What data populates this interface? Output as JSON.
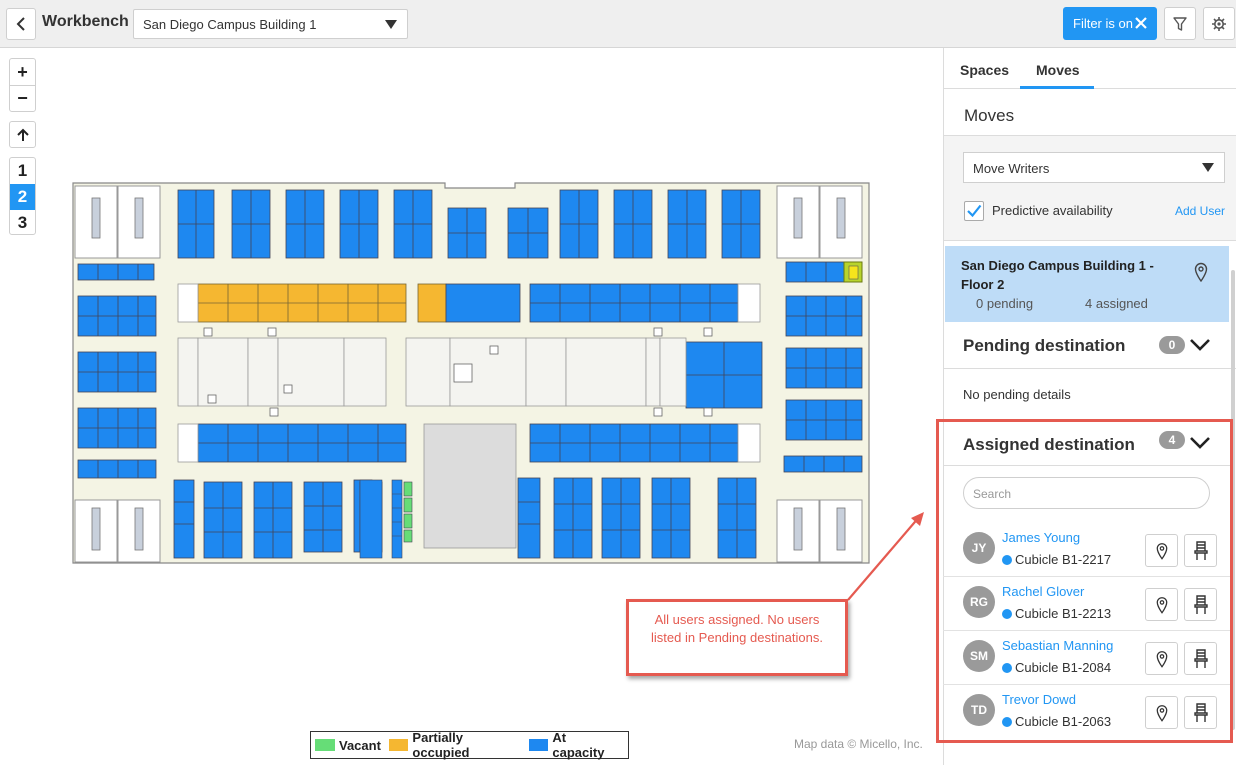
{
  "colors": {
    "accent": "#2196f3",
    "vacant": "#66dd77",
    "partially_occupied": "#f5b731",
    "at_capacity": "#1e88f0",
    "annotation": "#e55a50",
    "selected_card": "#bedcf7"
  },
  "toolbar": {
    "back_icon": "chevron-left-icon",
    "title": "Workbench",
    "building_select": "San Diego Campus Building 1",
    "filter_label": "Filter is on",
    "filter_icon": "funnel-icon",
    "settings_icon": "gear-icon"
  },
  "map_controls": {
    "zoom_in": "+",
    "zoom_out": "−",
    "floors": [
      "1",
      "2",
      "3"
    ],
    "active_floor": "2"
  },
  "legend": {
    "vacant": "Vacant",
    "partial": "Partially occupied",
    "capacity": "At capacity"
  },
  "map_credit": "Map data © Micello, Inc.",
  "annotation": {
    "text": "All users assigned. No users listed in Pending destinations."
  },
  "panel": {
    "tabs": [
      "Spaces",
      "Moves"
    ],
    "active_tab": "Moves",
    "section_title": "Moves",
    "writers_select": "Move Writers",
    "predictive_label": "Predictive availability",
    "predictive_checked": true,
    "add_user": "Add User",
    "floor_card": {
      "name": "San Diego Campus Building 1 - Floor 2",
      "pending": "0 pending",
      "assigned": "4 assigned"
    },
    "pending": {
      "title": "Pending destination",
      "count": "0",
      "empty_text": "No pending details"
    },
    "assigned": {
      "title": "Assigned destination",
      "count": "4",
      "search_placeholder": "Search",
      "users": [
        {
          "initials": "JY",
          "name": "James Young",
          "location": "Cubicle B1-2217"
        },
        {
          "initials": "RG",
          "name": "Rachel Glover",
          "location": "Cubicle B1-2213"
        },
        {
          "initials": "SM",
          "name": "Sebastian Manning",
          "location": "Cubicle B1-2084"
        },
        {
          "initials": "TD",
          "name": "Trevor Dowd",
          "location": "Cubicle B1-2063"
        }
      ]
    }
  }
}
